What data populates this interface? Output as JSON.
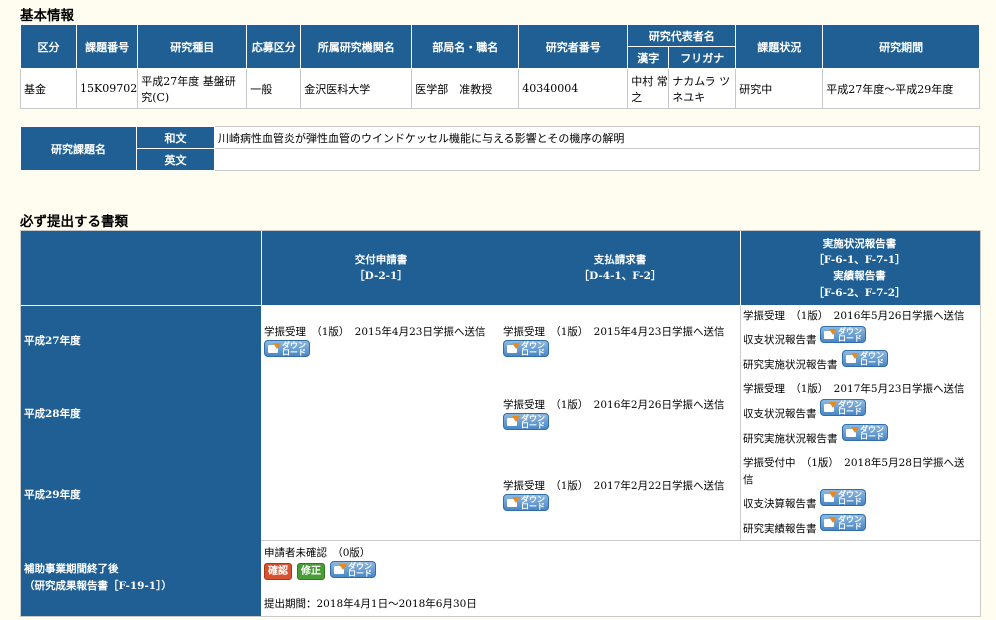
{
  "basic_info": {
    "section_title": "基本情報",
    "headers": {
      "kubun": "区分",
      "kadai_bango": "課題番号",
      "kenkyu_shumoku": "研究種目",
      "oubo_kubun": "応募区分",
      "kikan": "所属研究機関名",
      "bukyoku": "部局名・職名",
      "kenkyusha_bango": "研究者番号",
      "daihyosha": "研究代表者名",
      "kanji": "漢字",
      "furigana": "フリガナ",
      "status": "課題状況",
      "period": "研究期間"
    },
    "row": {
      "kubun": "基金",
      "kadai_bango": "15K09702",
      "kenkyu_shumoku": "平成27年度 基盤研究(C)",
      "oubo_kubun": "一般",
      "kikan": "金沢医科大学",
      "bukyoku": "医学部　准教授",
      "kenkyusha_bango": "40340004",
      "kanji": "中村 常之",
      "furigana": "ナカムラ ツネユキ",
      "status": "研究中",
      "period": "平成27年度～平成29年度"
    }
  },
  "title_block": {
    "label": "研究課題名",
    "wabun_label": "和文",
    "wabun_value": "川崎病性血管炎が弾性血管のウインドケッセル機能に与える影響とその機序の解明",
    "eibun_label": "英文",
    "eibun_value": ""
  },
  "docs": {
    "section_title": "必ず提出する書類",
    "col1_title": "交付申請書",
    "col1_code": "［D-2-1］",
    "col2_title": "支払請求書",
    "col2_code": "［D-4-1、F-2］",
    "col3_title1": "実施状況報告書",
    "col3_code1": "［F-6-1、F-7-1］",
    "col3_title2": "実績報告書",
    "col3_code2": "［F-6-2、F-7-2］",
    "download_label_1": "ダウン",
    "download_label_2": "ロード",
    "rows": {
      "h27": {
        "label": "平成27年度",
        "c1": "学振受理　（1版）　2015年4月23日学振へ送信",
        "c2": "学振受理　（1版）　2015年4月23日学振へ送信",
        "c3": "学振受理　（1版）　2016年5月26日学振へ送信",
        "c3_doc1": "収支状況報告書",
        "c3_doc2": "研究実施状況報告書"
      },
      "h28": {
        "label": "平成28年度",
        "c2": "学振受理　（1版）　2016年2月26日学振へ送信",
        "c3": "学振受理　（1版）　2017年5月23日学振へ送信",
        "c3_doc1": "収支状況報告書",
        "c3_doc2": "研究実施状況報告書"
      },
      "h29": {
        "label": "平成29年度",
        "c2": "学振受理　（1版）　2017年2月22日学振へ送信",
        "c3_a": "学振受付中　（1版）　2018年5月28日学振へ送",
        "c3_b": "信",
        "c3_doc1": "収支決算報告書",
        "c3_doc2": "研究実績報告書"
      },
      "final": {
        "label1": "補助事業期間終了後",
        "label2": "（研究成果報告書［F-19-1］）",
        "status": "申請者未確認　（0版）",
        "confirm": "確認",
        "edit": "修正",
        "period": "提出期間：2018年4月1日～2018年6月30日"
      }
    }
  }
}
